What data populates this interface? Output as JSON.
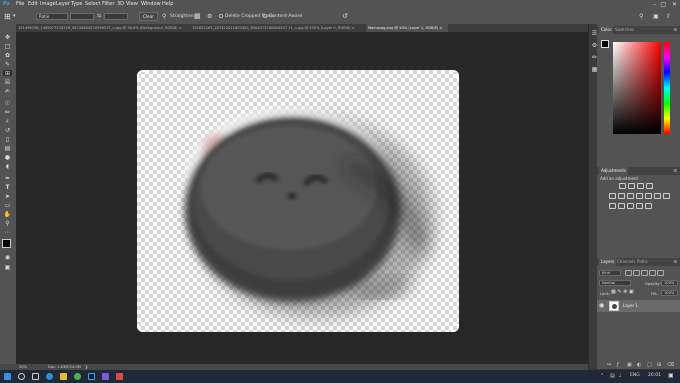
{
  "menu": {
    "logo": "Ps",
    "items": [
      "File",
      "Edit",
      "Image",
      "Layer",
      "Type",
      "Select",
      "Filter",
      "3D",
      "View",
      "Window",
      "Help"
    ]
  },
  "options": {
    "ratio_label": "Ratio",
    "clear_label": "Clear",
    "straighten_label": "Straighten",
    "delete_cropped_label": "Delete Cropped Pixels",
    "content_aware_label": "Content-Aware"
  },
  "tabs": [
    {
      "label": "151496708_1409077135378_5623480451659622T_n.jpg @ 36.6% (Background, RGB/8) ×"
    },
    {
      "label": "151621163_207422811803362_8406373160604257 11_n.jpg @ 250% (Layer 0, RGB/8) ×"
    },
    {
      "label": "Mamasag.png @ 50% (Layer 1, RGB/8) ×"
    }
  ],
  "status": {
    "zoom": "50%",
    "doc": "Doc: 1.83M/24.0M"
  },
  "panels": {
    "color_tab": "Color",
    "swatches_tab": "Swatches",
    "adjustments_tab": "Adjustments",
    "add_adjustment": "Add an adjustment",
    "layers_tab": "Layers",
    "channels_tab": "Channels",
    "paths_tab": "Paths",
    "kind_label": "Kind",
    "blend_mode": "Normal",
    "opacity_label": "Opacity:",
    "opacity_value": "100%",
    "lock_label": "Lock:",
    "fill_label": "Fill:",
    "fill_value": "100%",
    "layer_name": "Layer 1"
  },
  "taskbar": {
    "time": "20:01",
    "lang": "ENG"
  },
  "colors": {
    "accent": "#1473e6",
    "ui_dark": "#535353"
  }
}
